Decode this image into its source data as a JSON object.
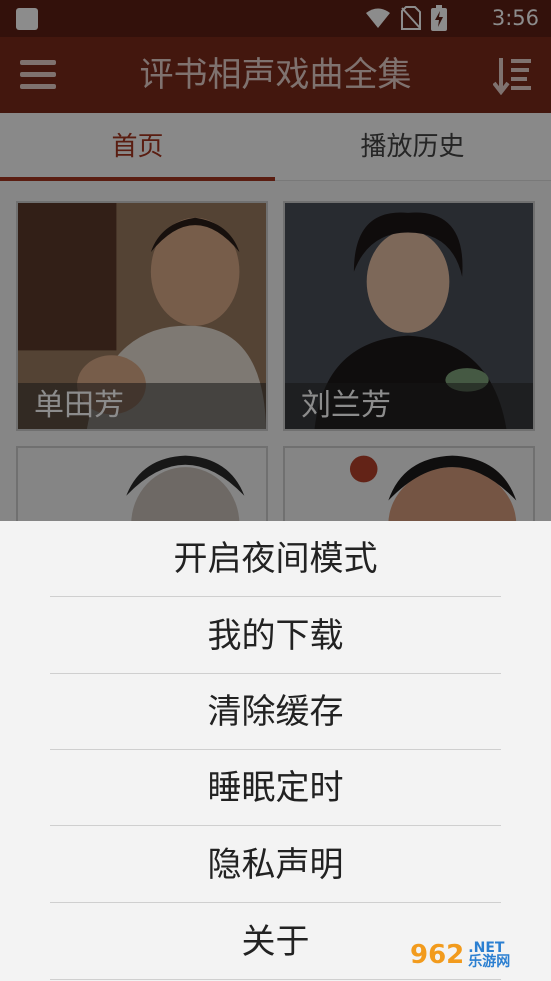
{
  "status_bar": {
    "time": "3:56"
  },
  "app_bar": {
    "title": "评书相声戏曲全集"
  },
  "tabs": [
    {
      "label": "首页",
      "active": true
    },
    {
      "label": "播放历史",
      "active": false
    }
  ],
  "cards": [
    {
      "name": "单田芳"
    },
    {
      "name": "刘兰芳"
    }
  ],
  "menu": {
    "items": [
      {
        "label": "开启夜间模式"
      },
      {
        "label": "我的下载"
      },
      {
        "label": "清除缓存"
      },
      {
        "label": "睡眠定时"
      },
      {
        "label": "隐私声明"
      },
      {
        "label": "关于"
      }
    ]
  },
  "watermark": {
    "number": "962",
    "net": ".NET",
    "site": "乐游网"
  }
}
